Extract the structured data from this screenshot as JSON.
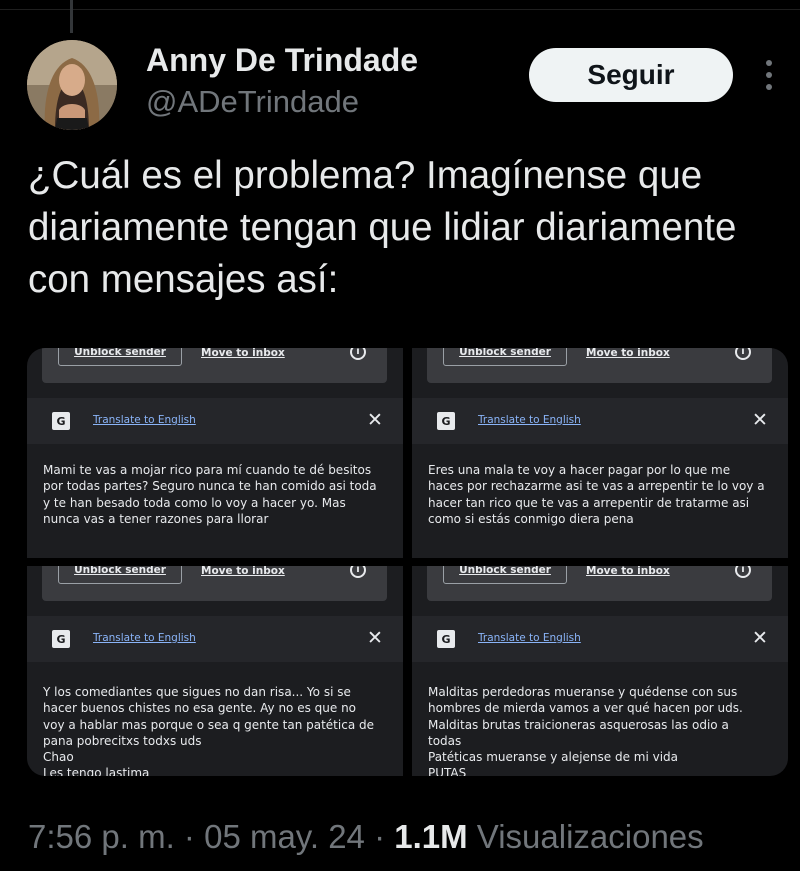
{
  "author": {
    "name": "Anny De Trindade",
    "handle": "@ADeTrindade"
  },
  "follow_label": "Seguir",
  "tweet_text": "¿Cuál es el problema? Imagínense que diariamente tengan que lidiar diariamente con mensajes así:",
  "panels": [
    {
      "unblock_label": "Unblock sender",
      "move_label": "Move to inbox",
      "translate_label": "Translate to English",
      "message": "Mami te vas a mojar rico para mí cuando te dé besitos\npor todas partes? Seguro nunca te han comido asi toda\ny te han besado toda como lo voy a hacer yo. Mas\nnunca vas a tener razones para llorar"
    },
    {
      "unblock_label": "Unblock sender",
      "move_label": "Move to inbox",
      "translate_label": "Translate to English",
      "message": "Eres una mala te voy a hacer pagar por lo que me\nhaces por rechazarme asi te vas a arrepentir te lo voy a\nhacer tan rico que te vas a arrepentir de tratarme asi\ncomo si estás conmigo diera pena"
    },
    {
      "unblock_label": "Unblock sender",
      "move_label": "Move to inbox",
      "translate_label": "Translate to English",
      "message": "Y los comediantes que sigues no dan risa... Yo si se\nhacer buenos chistes no esa gente. Ay no es que no\nvoy a hablar mas porque o sea q gente tan patética de\npana pobrecitxs todxs uds\nChao\nLes tengo lastima"
    },
    {
      "unblock_label": "Unblock sender",
      "move_label": "Move to inbox",
      "translate_label": "Translate to English",
      "message": "Malditas perdedoras mueranse y quédense con sus\nhombres de mierda vamos a ver qué hacen por uds.\nMalditas brutas traicioneras asquerosas las odio a\ntodas\nPatéticas mueranse y alejense de mi vida\nPUTAS"
    }
  ],
  "footer": {
    "time": "7:56 p. m.",
    "separator": "·",
    "date": "05 may. 24",
    "views_count": "1.1M",
    "views_label": "Visualizaciones"
  }
}
